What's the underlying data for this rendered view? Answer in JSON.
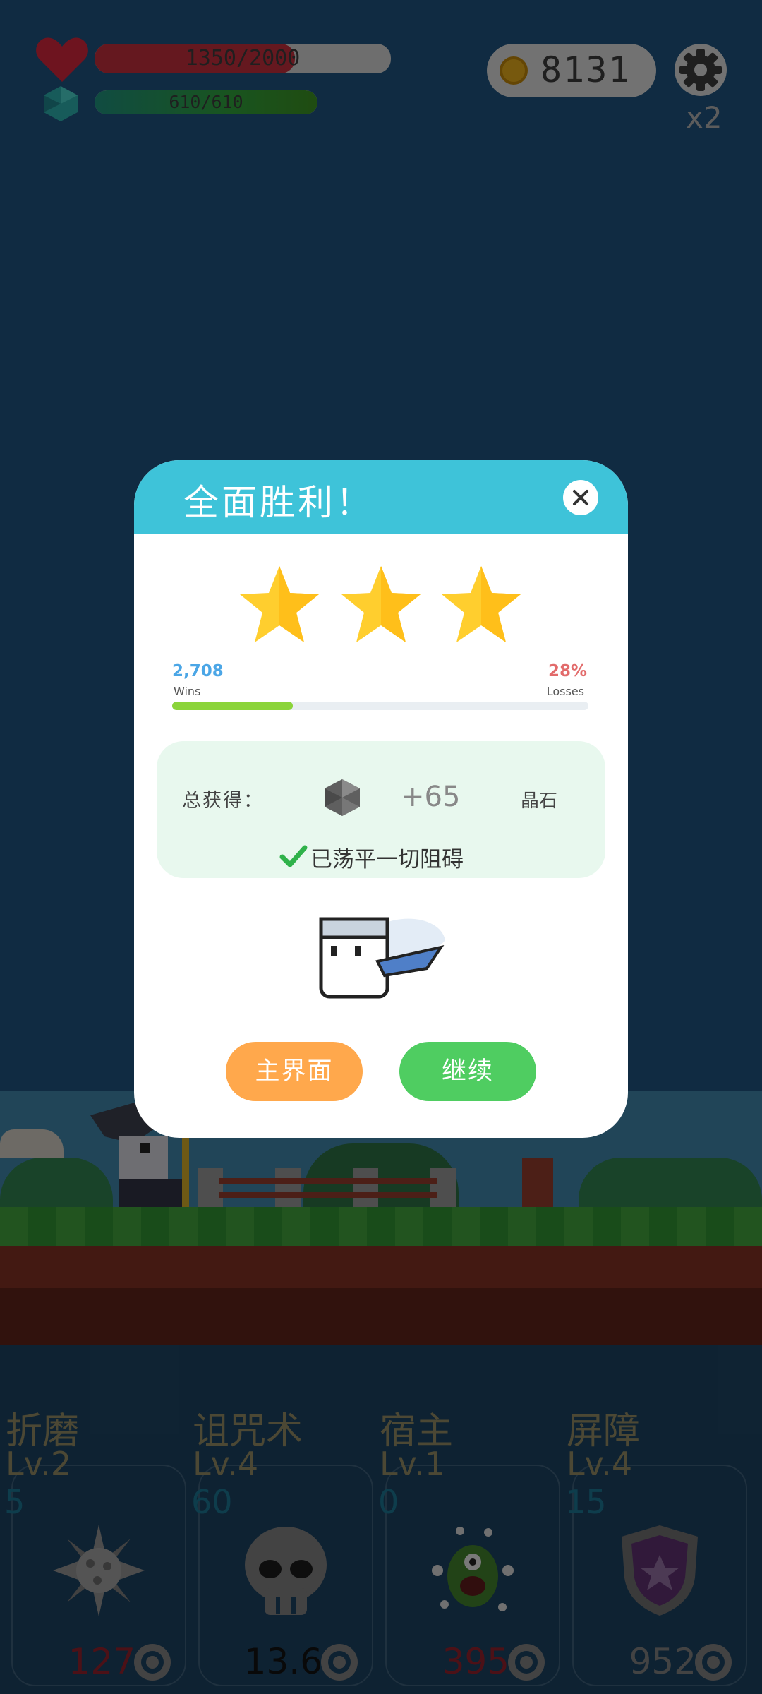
{
  "hud": {
    "hp_text": "1350/2000",
    "hp_fraction": 0.675,
    "mana_text": "610/610",
    "mana_fraction": 1.0,
    "coins": "8131",
    "speed": "x2",
    "icons": [
      "heart-icon",
      "crystal-icon",
      "coin-icon",
      "gear-icon"
    ]
  },
  "dialog": {
    "title": "全面胜利！",
    "stars": 3,
    "wins_value": "2,708",
    "wins_label": "Wins",
    "losses_value": "28%",
    "losses_label": "Losses",
    "progress_fraction": 0.29,
    "reward_label": "总获得：",
    "reward_amount": "+65",
    "reward_unit": "晶石",
    "reward_note": "已荡平一切阻碍",
    "main_button": "主界面",
    "continue_button": "继续"
  },
  "skills": [
    {
      "name": "折磨",
      "level": "Lv.2",
      "count": "5",
      "cost": "127",
      "cost_color": "#8a1f2a",
      "icon": "spiked-mine-icon"
    },
    {
      "name": "诅咒术",
      "level": "Lv.4",
      "count": "60",
      "cost": "13.6",
      "cost_color": "#111111",
      "icon": "skull-icon"
    },
    {
      "name": "宿主",
      "level": "Lv.1",
      "count": "0",
      "cost": "395",
      "cost_color": "#8a1f2a",
      "icon": "green-monster-icon"
    },
    {
      "name": "屏障",
      "level": "Lv.4",
      "count": "15",
      "cost": "952",
      "cost_color": "#7a7a7a",
      "icon": "star-shield-icon"
    }
  ],
  "colors": {
    "header": "#3ec3d9",
    "main_button": "#ffa84c",
    "continue_button": "#4fcd61",
    "wins": "#4ba6e6",
    "losses": "#e26b6b",
    "progress": "#8bd43a"
  }
}
